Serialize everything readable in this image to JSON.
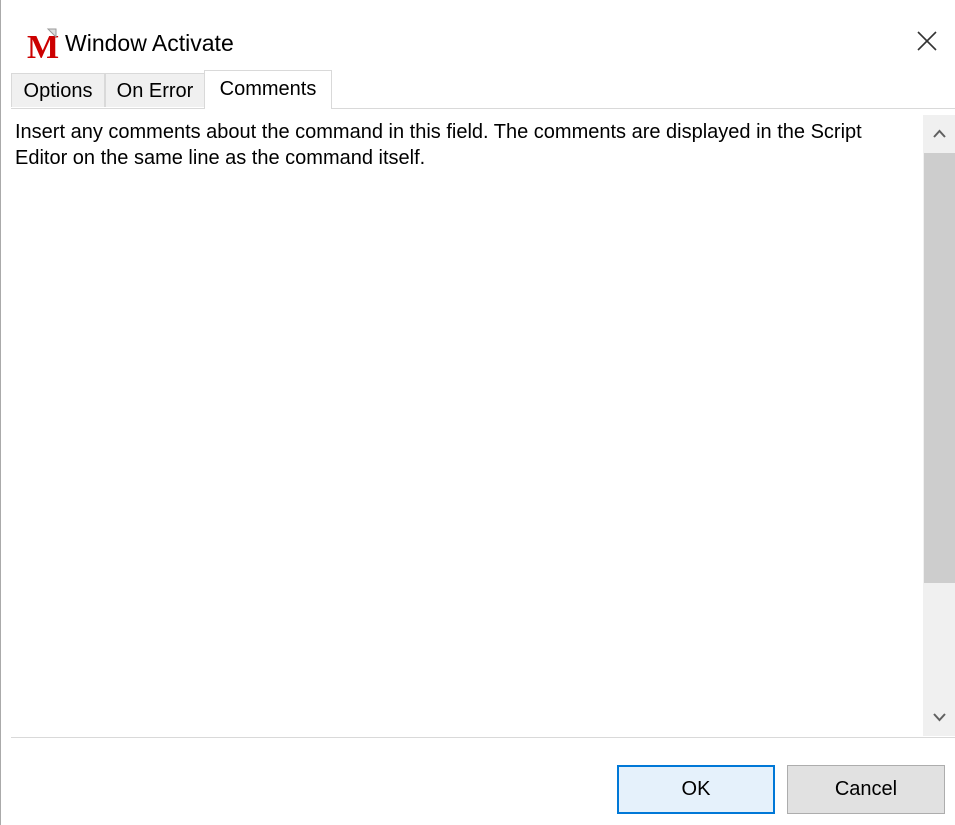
{
  "window": {
    "title": "Window Activate",
    "app_icon_letter": "M",
    "accent_color": "#cc0000"
  },
  "tabs": [
    {
      "label": "Options",
      "active": false
    },
    {
      "label": "On Error",
      "active": false
    },
    {
      "label": "Comments",
      "active": true
    }
  ],
  "comments": {
    "value": "Insert any comments about the command in this field. The comments are displayed in the Script Editor on the same line as the command itself."
  },
  "buttons": {
    "ok_label": "OK",
    "cancel_label": "Cancel"
  },
  "icons": {
    "close": "close-icon",
    "scroll_up": "chevron-up-icon",
    "scroll_down": "chevron-down-icon"
  }
}
